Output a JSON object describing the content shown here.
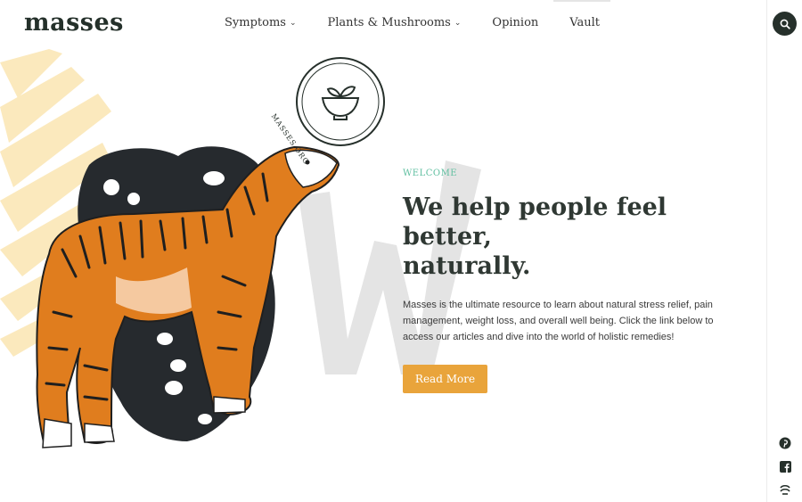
{
  "header": {
    "logo": "masses",
    "nav": [
      {
        "label": "Symptoms",
        "has_dropdown": true
      },
      {
        "label": "Plants & Mushrooms",
        "has_dropdown": true
      },
      {
        "label": "Opinion",
        "has_dropdown": false
      },
      {
        "label": "Vault",
        "has_dropdown": false
      }
    ],
    "search_icon": "search-icon"
  },
  "badge": {
    "text": "MASSES.ORG",
    "icon": "bowl-icon"
  },
  "hero": {
    "eyebrow": "WELCOME",
    "headline_line1": "We help people feel better,",
    "headline_line2": "naturally.",
    "description": "Masses is the ultimate resource to learn about natural stress relief, pain management, weight loss, and overall well being. Click the link below to access our articles and dive into the world of holistic remedies!",
    "button_label": "Read More"
  },
  "social": [
    "pinterest-icon",
    "facebook-icon",
    "mix-icon"
  ],
  "colors": {
    "brand_dark": "#26302b",
    "accent_orange": "#e9a43b",
    "welcome_teal": "#5fbfa0",
    "tiger_orange": "#e07d1e",
    "leaf_yellow": "#fbe9bd"
  }
}
